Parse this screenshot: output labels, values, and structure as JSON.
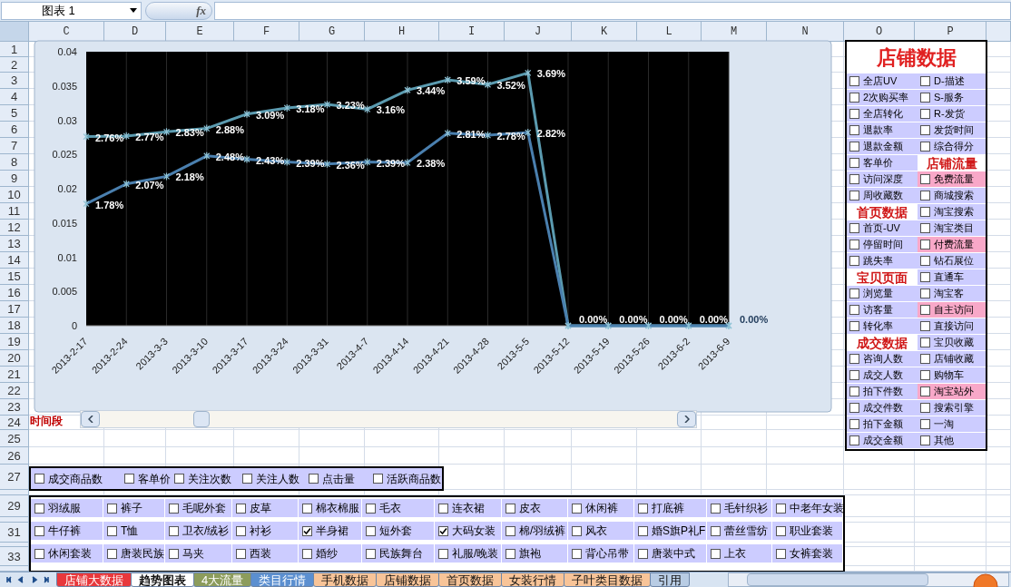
{
  "name_box": {
    "value": "图表 1"
  },
  "formula_bar": {
    "fx_label": "fx"
  },
  "columns": [
    "C",
    "D",
    "E",
    "F",
    "G",
    "H",
    "I",
    "J",
    "K",
    "L",
    "M",
    "N",
    "O",
    "P"
  ],
  "row_headers": [
    "1",
    "2",
    "3",
    "4",
    "5",
    "6",
    "7",
    "8",
    "9",
    "10",
    "11",
    "12",
    "13",
    "14",
    "15",
    "16",
    "17",
    "18",
    "19",
    "20",
    "21",
    "22",
    "23",
    "24",
    "25",
    "26",
    "27",
    "29",
    "31",
    "33"
  ],
  "chart": {
    "chart_data": {
      "type": "line",
      "categories": [
        "2013-2-17",
        "2013-2-24",
        "2013-3-3",
        "2013-3-10",
        "2013-3-17",
        "2013-3-24",
        "2013-3-31",
        "2013-4-7",
        "2013-4-14",
        "2013-4-21",
        "2013-4-28",
        "2013-5-5",
        "2013-5-12",
        "2013-5-19",
        "2013-5-26",
        "2013-6-2",
        "2013-6-9"
      ],
      "series": [
        {
          "color": "#5b9bb0",
          "values": [
            0.0276,
            0.0277,
            0.0283,
            0.0288,
            0.0309,
            0.0318,
            0.0323,
            0.0316,
            0.0344,
            0.0359,
            0.0352,
            0.0369,
            0,
            0,
            0,
            0,
            0
          ]
        },
        {
          "color": "#4a7fae",
          "values": [
            0.0178,
            0.0207,
            0.0218,
            0.0248,
            0.0243,
            0.0239,
            0.0236,
            0.0239,
            0.0238,
            0.0281,
            0.0278,
            0.0282,
            0,
            0,
            0,
            0,
            0
          ]
        }
      ],
      "grid": true,
      "ylim": [
        0,
        0.04
      ],
      "yticks": [
        0,
        0.005,
        0.01,
        0.015,
        0.02,
        0.025,
        0.03,
        0.035,
        0.04
      ],
      "value_labels": [
        [
          "2.76%",
          "2.77%",
          "2.83%",
          "2.88%",
          "3.09%",
          "3.18%",
          "3.23%",
          "3.16%",
          "3.44%",
          "3.59%",
          "3.52%",
          "3.69%",
          "0.00%",
          "0.00%",
          "0.00%",
          "0.00%",
          "0.00%"
        ],
        [
          "1.78%",
          "2.07%",
          "2.18%",
          "2.48%",
          "2.43%",
          "2.39%",
          "2.36%",
          "2.39%",
          "2.38%",
          "2.81%",
          "2.78%",
          "2.82%",
          null,
          null,
          null,
          null,
          null
        ]
      ]
    },
    "scroll_label": "时间段"
  },
  "panel": {
    "title": "店铺数据",
    "columns": [
      [
        {
          "kind": "checkbox",
          "label": "全店UV",
          "checked": false,
          "highlighted": false
        },
        {
          "kind": "checkbox",
          "label": "2次购买率",
          "checked": false,
          "highlighted": false
        },
        {
          "kind": "checkbox",
          "label": "全店转化",
          "checked": false,
          "highlighted": false
        },
        {
          "kind": "checkbox",
          "label": "退款率",
          "checked": false,
          "highlighted": false
        },
        {
          "kind": "checkbox",
          "label": "退款金额",
          "checked": false,
          "highlighted": false
        },
        {
          "kind": "checkbox",
          "label": "客单价",
          "checked": false,
          "highlighted": false
        },
        {
          "kind": "checkbox",
          "label": "访问深度",
          "checked": false,
          "highlighted": false
        },
        {
          "kind": "checkbox",
          "label": "周收藏数",
          "checked": false,
          "highlighted": false
        },
        {
          "kind": "header",
          "label": "首页数据"
        },
        {
          "kind": "checkbox",
          "label": "首页-UV",
          "checked": false,
          "highlighted": false
        },
        {
          "kind": "checkbox",
          "label": "停留时间",
          "checked": false,
          "highlighted": false
        },
        {
          "kind": "checkbox",
          "label": "跳失率",
          "checked": false,
          "highlighted": false
        },
        {
          "kind": "header",
          "label": "宝贝页面"
        },
        {
          "kind": "checkbox",
          "label": "浏览量",
          "checked": false,
          "highlighted": false
        },
        {
          "kind": "checkbox",
          "label": "访客量",
          "checked": false,
          "highlighted": false
        },
        {
          "kind": "checkbox",
          "label": "转化率",
          "checked": false,
          "highlighted": false
        },
        {
          "kind": "header",
          "label": "成交数据"
        },
        {
          "kind": "checkbox",
          "label": "咨询人数",
          "checked": false,
          "highlighted": false
        },
        {
          "kind": "checkbox",
          "label": "成交人数",
          "checked": false,
          "highlighted": false
        },
        {
          "kind": "checkbox",
          "label": "拍下件数",
          "checked": false,
          "highlighted": false
        },
        {
          "kind": "checkbox",
          "label": "成交件数",
          "checked": false,
          "highlighted": false
        },
        {
          "kind": "checkbox",
          "label": "拍下金额",
          "checked": false,
          "highlighted": false
        },
        {
          "kind": "checkbox",
          "label": "成交金额",
          "checked": false,
          "highlighted": false
        }
      ],
      [
        {
          "kind": "checkbox",
          "label": "D-描述",
          "checked": false,
          "highlighted": false
        },
        {
          "kind": "checkbox",
          "label": "S-服务",
          "checked": false,
          "highlighted": false
        },
        {
          "kind": "checkbox",
          "label": "R-发货",
          "checked": false,
          "highlighted": false
        },
        {
          "kind": "checkbox",
          "label": "发货时间",
          "checked": false,
          "highlighted": false
        },
        {
          "kind": "checkbox",
          "label": "综合得分",
          "checked": false,
          "highlighted": false
        },
        {
          "kind": "header",
          "label": "店铺流量"
        },
        {
          "kind": "checkbox",
          "label": "免费流量",
          "checked": false,
          "highlighted": true
        },
        {
          "kind": "checkbox",
          "label": "商城搜索",
          "checked": false,
          "highlighted": false
        },
        {
          "kind": "checkbox",
          "label": "淘宝搜索",
          "checked": false,
          "highlighted": false
        },
        {
          "kind": "checkbox",
          "label": "淘宝类目",
          "checked": false,
          "highlighted": false
        },
        {
          "kind": "checkbox",
          "label": "付费流量",
          "checked": false,
          "highlighted": true
        },
        {
          "kind": "checkbox",
          "label": "钻石展位",
          "checked": false,
          "highlighted": false
        },
        {
          "kind": "checkbox",
          "label": "直通车",
          "checked": false,
          "highlighted": false
        },
        {
          "kind": "checkbox",
          "label": "淘宝客",
          "checked": false,
          "highlighted": false
        },
        {
          "kind": "checkbox",
          "label": "自主访问",
          "checked": false,
          "highlighted": true
        },
        {
          "kind": "checkbox",
          "label": "直接访问",
          "checked": false,
          "highlighted": false
        },
        {
          "kind": "checkbox",
          "label": "宝贝收藏",
          "checked": false,
          "highlighted": false
        },
        {
          "kind": "checkbox",
          "label": "店铺收藏",
          "checked": false,
          "highlighted": false
        },
        {
          "kind": "checkbox",
          "label": "购物车",
          "checked": false,
          "highlighted": false
        },
        {
          "kind": "checkbox",
          "label": "淘宝站外",
          "checked": false,
          "highlighted": true
        },
        {
          "kind": "checkbox",
          "label": "搜索引擎",
          "checked": false,
          "highlighted": false
        },
        {
          "kind": "checkbox",
          "label": "一淘",
          "checked": false,
          "highlighted": false
        },
        {
          "kind": "checkbox",
          "label": "其他",
          "checked": false,
          "highlighted": false
        }
      ]
    ]
  },
  "metric_options": [
    {
      "label": "成交商品数",
      "checked": false
    },
    {
      "label": "客单价",
      "checked": false
    },
    {
      "label": "关注次数",
      "checked": false
    },
    {
      "label": "关注人数",
      "checked": false
    },
    {
      "label": "点击量",
      "checked": false
    },
    {
      "label": "活跃商品数",
      "checked": false
    }
  ],
  "category_options": [
    [
      {
        "label": "羽绒服",
        "checked": false
      },
      {
        "label": "裤子",
        "checked": false
      },
      {
        "label": "毛呢外套",
        "checked": false
      },
      {
        "label": "皮草",
        "checked": false
      },
      {
        "label": "棉衣棉服",
        "checked": false
      },
      {
        "label": "毛衣",
        "checked": false
      },
      {
        "label": "连衣裙",
        "checked": false
      },
      {
        "label": "皮衣",
        "checked": false
      },
      {
        "label": "休闲裤",
        "checked": false
      },
      {
        "label": "打底裤",
        "checked": false
      },
      {
        "label": "毛针织衫",
        "checked": false
      },
      {
        "label": "中老年女装",
        "checked": false
      }
    ],
    [
      {
        "label": "牛仔裤",
        "checked": false
      },
      {
        "label": "T恤",
        "checked": false
      },
      {
        "label": "卫衣/绒衫",
        "checked": false
      },
      {
        "label": "衬衫",
        "checked": false
      },
      {
        "label": "半身裙",
        "checked": true
      },
      {
        "label": "短外套",
        "checked": false
      },
      {
        "label": "大码女装",
        "checked": true
      },
      {
        "label": "棉/羽绒裤",
        "checked": false
      },
      {
        "label": "风衣",
        "checked": false
      },
      {
        "label": "婚S旗P礼F",
        "checked": false
      },
      {
        "label": "蕾丝雪纺",
        "checked": false
      },
      {
        "label": "职业套装",
        "checked": false
      }
    ],
    [
      {
        "label": "休闲套装",
        "checked": false
      },
      {
        "label": "唐装民族",
        "checked": false
      },
      {
        "label": "马夹",
        "checked": false
      },
      {
        "label": "西装",
        "checked": false
      },
      {
        "label": "婚纱",
        "checked": false
      },
      {
        "label": "民族舞台",
        "checked": false
      },
      {
        "label": "礼服/晚装",
        "checked": false
      },
      {
        "label": "旗袍",
        "checked": false
      },
      {
        "label": "背心吊带",
        "checked": false
      },
      {
        "label": "唐装中式",
        "checked": false
      },
      {
        "label": "上衣",
        "checked": false
      },
      {
        "label": "女裤套装",
        "checked": false
      }
    ]
  ],
  "sheet_tabs": [
    {
      "label": "店铺大数据",
      "selected": false,
      "color": "#e8383c"
    },
    {
      "label": "趋势图表",
      "selected": true,
      "color": "#ffffff"
    },
    {
      "label": "4大流量",
      "selected": false,
      "color": "#8c9c5c"
    },
    {
      "label": "类目行情",
      "selected": false,
      "color": "#5b8fd0"
    },
    {
      "label": "手机数据",
      "selected": false,
      "color": "#f8c498"
    },
    {
      "label": "店铺数据",
      "selected": false,
      "color": "#f8c498"
    },
    {
      "label": "首页数据",
      "selected": false,
      "color": "#f8c498"
    },
    {
      "label": "女装行情",
      "selected": false,
      "color": "#f8c498"
    },
    {
      "label": "子叶类目数据",
      "selected": false,
      "color": "#f8c498"
    },
    {
      "label": "引用",
      "selected": false,
      "color": "#b8cce4"
    }
  ]
}
